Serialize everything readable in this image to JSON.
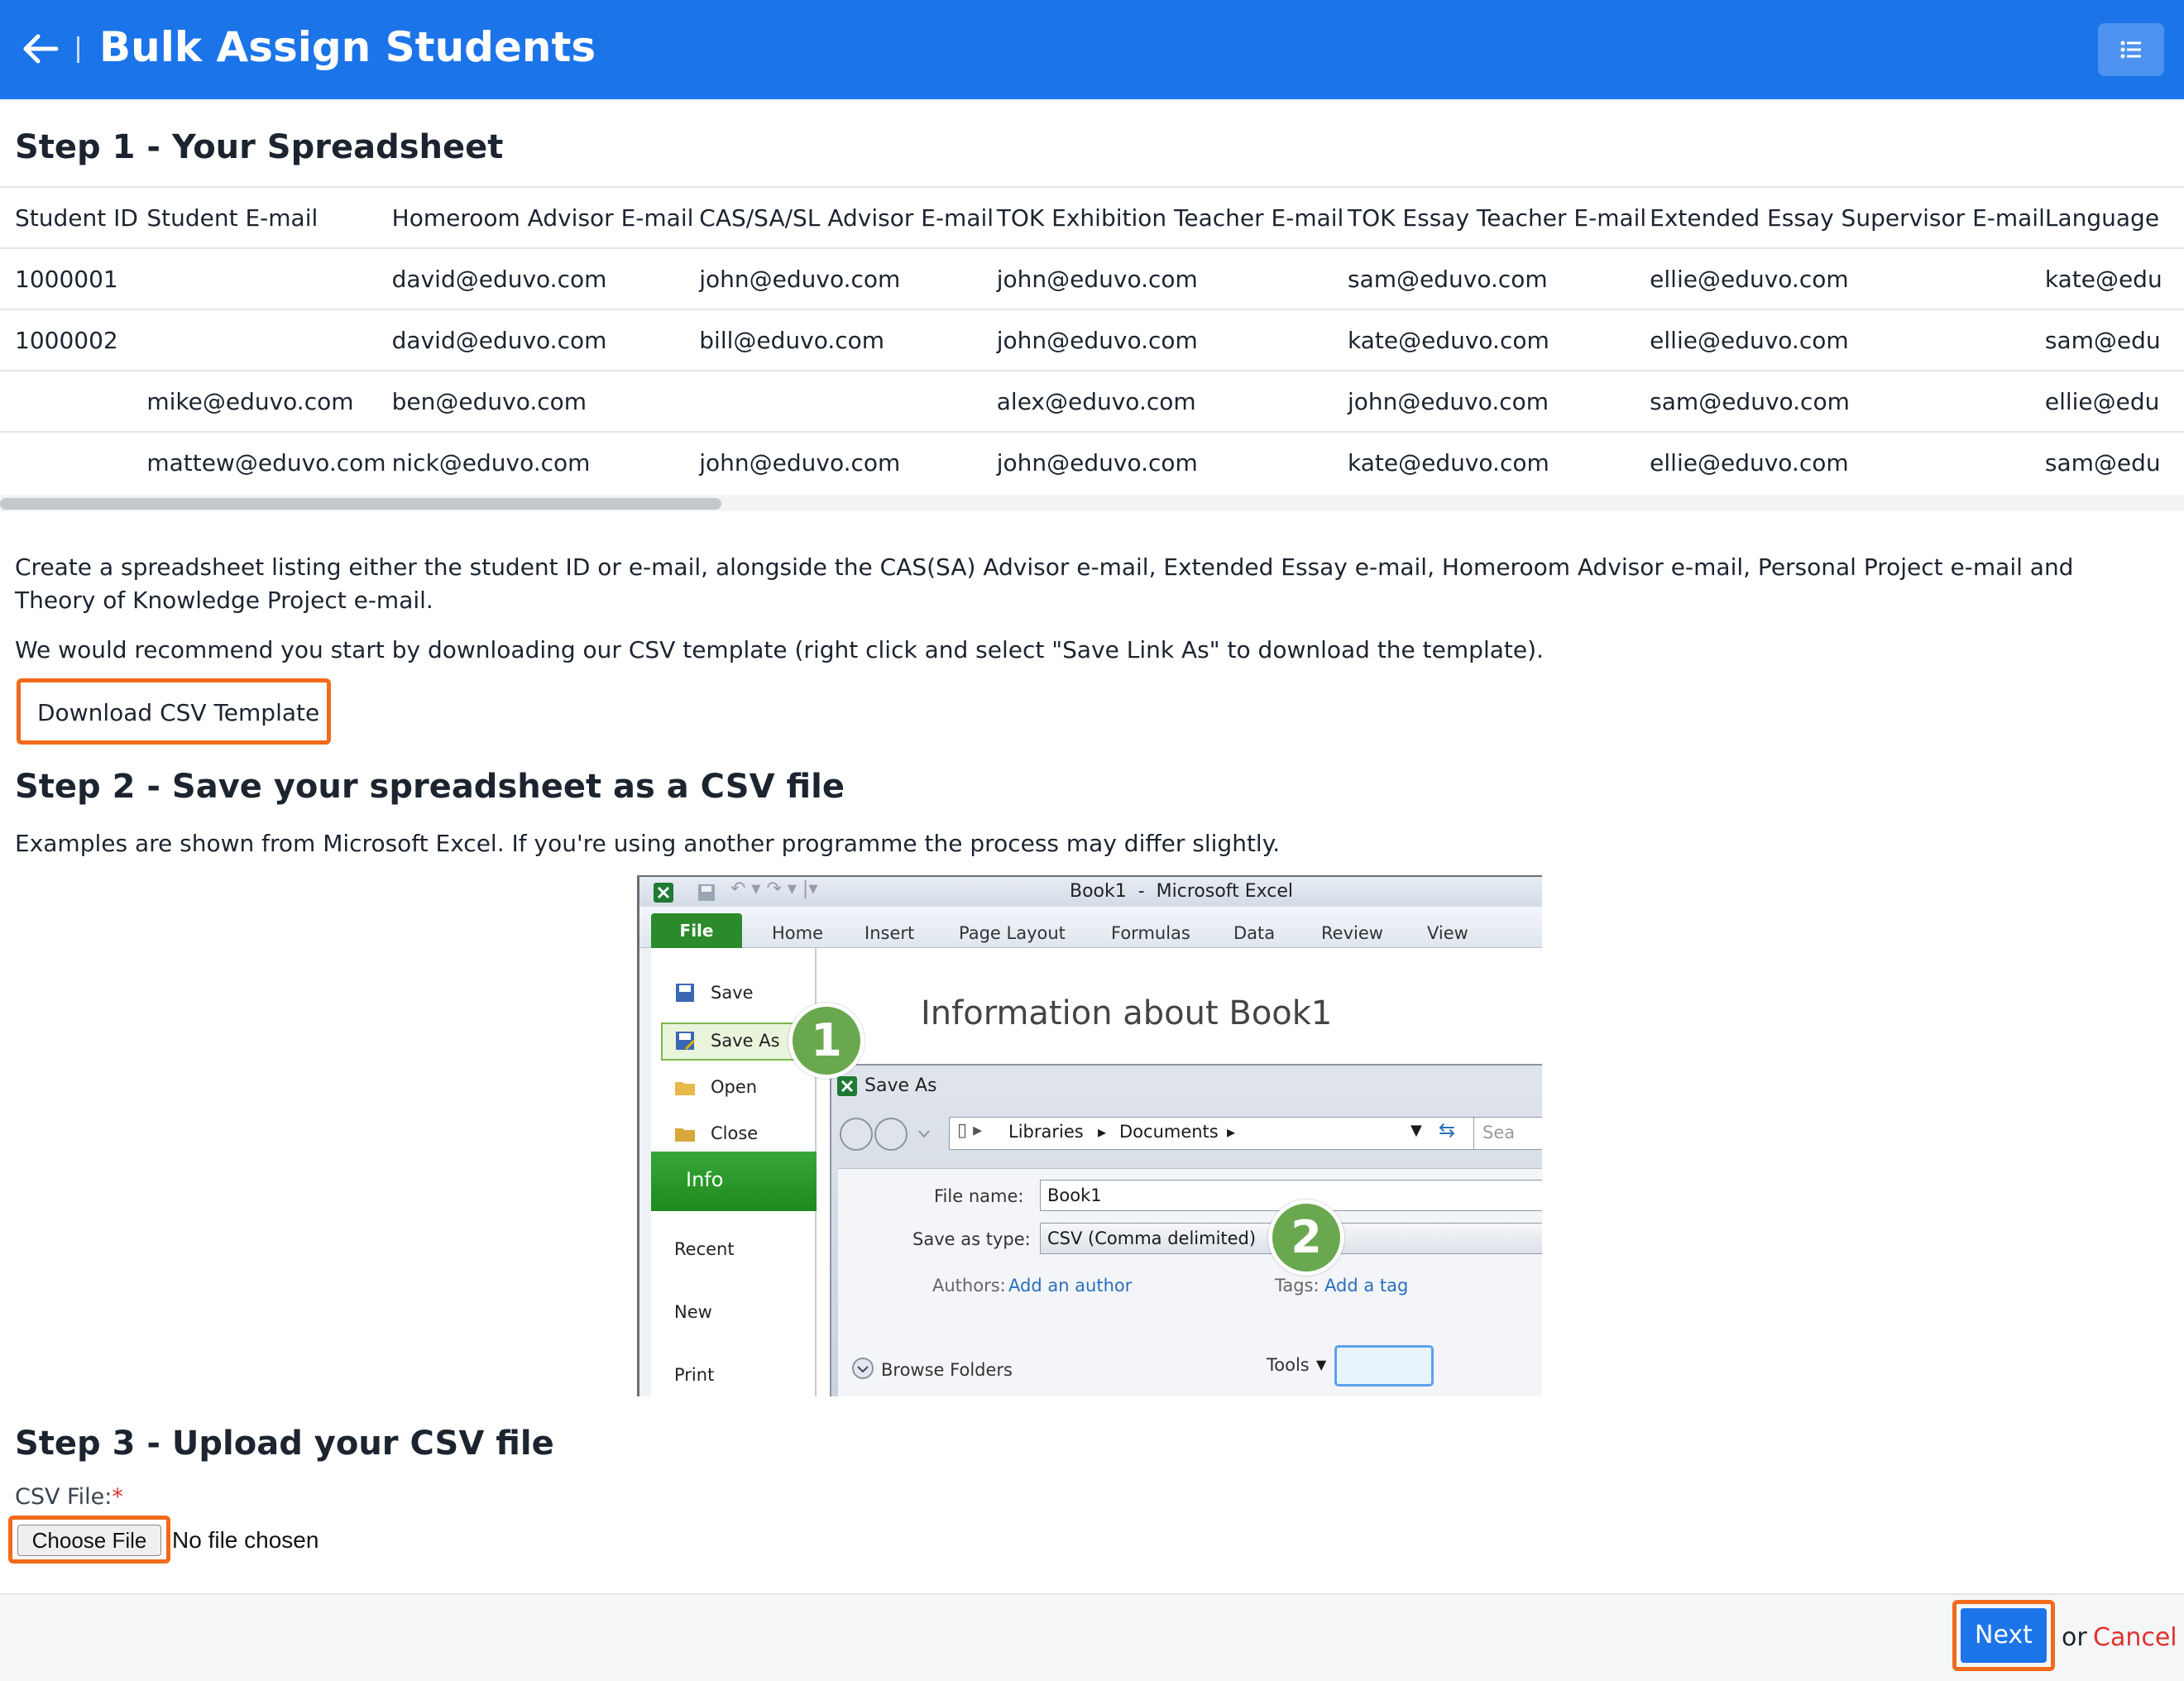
{
  "header": {
    "title": "Bulk Assign Students"
  },
  "step1": {
    "heading": "Step 1 - Your Spreadsheet",
    "table": {
      "columns": [
        "Student ID",
        "Student E-mail",
        "Homeroom Advisor E-mail",
        "CAS/SA/SL Advisor E-mail",
        "TOK Exhibition Teacher E-mail",
        "TOK Essay Teacher E-mail",
        "Extended Essay Supervisor E-mail",
        "Language"
      ],
      "rows": [
        [
          "1000001",
          "",
          "david@eduvo.com",
          "john@eduvo.com",
          "john@eduvo.com",
          "sam@eduvo.com",
          "ellie@eduvo.com",
          "kate@edu"
        ],
        [
          "1000002",
          "",
          "david@eduvo.com",
          "bill@eduvo.com",
          "john@eduvo.com",
          "kate@eduvo.com",
          "ellie@eduvo.com",
          "sam@edu"
        ],
        [
          "",
          "mike@eduvo.com",
          "ben@eduvo.com",
          "",
          "alex@eduvo.com",
          "john@eduvo.com",
          "sam@eduvo.com",
          "ellie@edu"
        ],
        [
          "",
          "mattew@eduvo.com",
          "nick@eduvo.com",
          "john@eduvo.com",
          "john@eduvo.com",
          "kate@eduvo.com",
          "ellie@eduvo.com",
          "sam@edu"
        ]
      ]
    },
    "description": "Create a spreadsheet listing either the student ID or e-mail, alongside the CAS(SA) Advisor e-mail, Extended Essay e-mail, Homeroom Advisor e-mail, Personal Project e-mail and Theory of Knowledge Project e-mail.",
    "recommendation": "We would recommend you start by downloading our CSV template (right click and select \"Save Link As\" to download the template).",
    "download_label": "Download CSV Template"
  },
  "step2": {
    "heading": "Step 2 - Save your spreadsheet as a CSV file",
    "description": "Examples are shown from Microsoft Excel. If you're using another programme the process may differ slightly.",
    "excel": {
      "window_title": "Book1  -  Microsoft Excel",
      "file_tab": "File",
      "ribbon_tabs": [
        "Home",
        "Insert",
        "Page Layout",
        "Formulas",
        "Data",
        "Review",
        "View"
      ],
      "left_menu": [
        "Save",
        "Save As",
        "Open",
        "Close",
        "Info",
        "Recent",
        "New",
        "Print"
      ],
      "info_title": "Information about Book1",
      "dialog_title": "Save As",
      "breadcrumb": [
        "Libraries",
        "Documents"
      ],
      "search_placeholder": "Sea",
      "file_name_label": "File name:",
      "file_name_value": "Book1",
      "save_type_label": "Save as type:",
      "save_type_value": "CSV (Comma delimited)",
      "authors_label": "Authors:",
      "authors_link": "Add an author",
      "tags_label": "Tags:",
      "tags_link": "Add a tag",
      "browse_folders": "Browse Folders",
      "tools": "Tools",
      "badge1": "1",
      "badge2": "2"
    }
  },
  "step3": {
    "heading": "Step 3 - Upload your CSV file",
    "csv_label": "CSV File:",
    "required_mark": "*",
    "choose_file": "Choose File",
    "no_file": "No file chosen"
  },
  "footer": {
    "next": "Next",
    "or": "or",
    "cancel": "Cancel"
  },
  "colors": {
    "brand_blue": "#1c74e9",
    "highlight_orange": "#f26a1b",
    "cancel_red": "#e0322e",
    "excel_green": "#2b8a2b"
  }
}
